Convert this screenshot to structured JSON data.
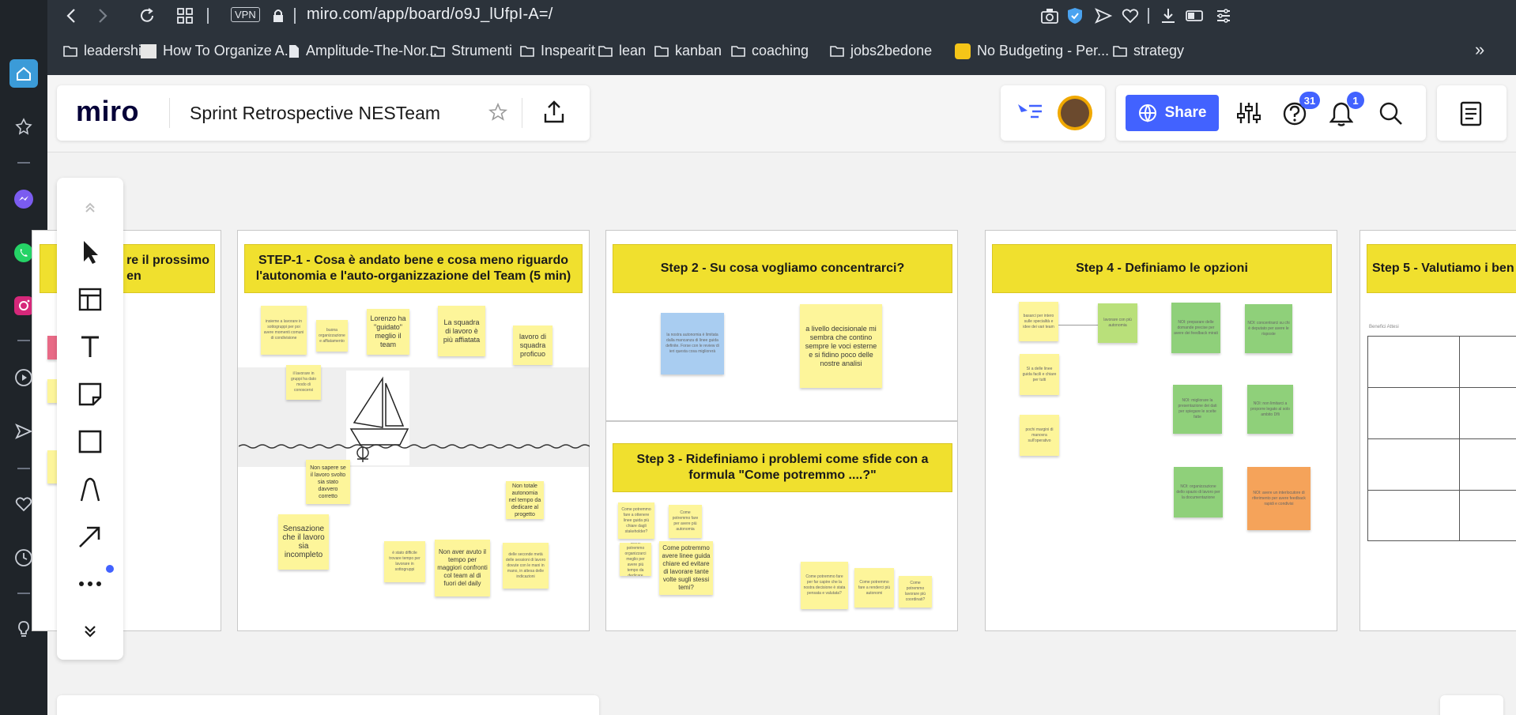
{
  "browser": {
    "vpn_label": "VPN",
    "url": "miro.com/app/board/o9J_lUfpI-A=/",
    "bookmarks_overflow": "»",
    "bookmarks": [
      {
        "label": "leadership",
        "icon": "folder-icon"
      },
      {
        "label": "How To Organize A...",
        "icon": "page-thumb-icon"
      },
      {
        "label": "Amplitude-The-Nor...",
        "icon": "document-icon"
      },
      {
        "label": "Strumenti",
        "icon": "folder-icon"
      },
      {
        "label": "Inspearit",
        "icon": "folder-icon"
      },
      {
        "label": "lean",
        "icon": "folder-icon"
      },
      {
        "label": "kanban",
        "icon": "folder-icon"
      },
      {
        "label": "coaching",
        "icon": "folder-icon"
      },
      {
        "label": "jobs2bedone",
        "icon": "folder-icon"
      },
      {
        "label": "No Budgeting - Per...",
        "icon": "favicon-icon"
      },
      {
        "label": "strategy",
        "icon": "folder-icon"
      }
    ]
  },
  "miro": {
    "logo": "miro",
    "board_title": "Sprint Retrospective NESTeam",
    "share_label": "Share",
    "help_badge": "31",
    "notif_badge": "1"
  },
  "frames": {
    "f0_header": "re     il prossimo\nen",
    "f1_header": "STEP-1 - Cosa è andato bene e cosa meno riguardo l'autonomia e l'auto-organizzazione del Team (5 min)",
    "f2_header": "Step 2 - Su cosa vogliamo concentrarci?",
    "f3_header": "Step 3 - Ridefiniamo i problemi come sfide con a formula \"Come potremmo ....?\"",
    "f4_header": "Step 4 - Definiamo le opzioni",
    "f5_header": "Step 5 - Valutiamo i ben",
    "f5_label": "Benefici Attesi"
  },
  "notes": {
    "s1_lorenzo": "Lorenzo ha \"guidato\" meglio il team",
    "s1_squadra": "La squadra di lavoro è più affiatata",
    "s1_lavoro": "lavoro di squadra proficuo",
    "s1_non_sapere": "Non sapere se il lavoro svolto sia stato davvero corretto",
    "s1_sensazione": "Sensazione che il lavoro sia incompleto",
    "s1_non_aver": "Non aver avuto il tempo per maggiori confronti col team al di fuori del daily",
    "s1_difficile": "è stato difficile trovare tempo per lavorare in sottogruppi",
    "s1_non_totale": "Non totale autonomia nel tempo da dedicare al progetto",
    "s1_tiny_a": "insieme a lavorare in sottogruppi per poi avere momenti comuni di condivisione",
    "s1_tiny_b": "buona organizzazione e affiatamento",
    "s1_tiny_c": "il lavorare in gruppi ha dato modo di conoscersi",
    "s1_tiny_d": "delle seconde metà delle sessioni di lavoro dovute con le mani in mano, in attesa delle indicazioni",
    "s2_blue": "la nostra autonomia è limitata dalla mancanza di linee guida definite. Forse con le review di ieri questa cosa migliorerà",
    "s2_yellow": "a livello decisionale mi sembra che contino sempre le voci esterne e si fidino poco delle nostre analisi",
    "s3_chiare": "Come potremmo avere linee guida chiare ed evitare di lavorare tante volte sugli stessi temi?",
    "s3_tiny_a": "Come potremmo fare a ottenere linee guida più chiare dagli stakeholder?",
    "s3_tiny_b": "Come potremmo fare per avere più autonomia",
    "s3_tiny_c": "Come potremmo organizzarci meglio per avere più tempo da dedicare",
    "s3_tiny_d": "Come potremmo fare per far capire che la nostra decisione è stata pensata e valutata?",
    "s3_tiny_e": "Come potremmo fare a renderci più autonomi",
    "s3_tiny_f": "Come potremmo lavorare più coordinati?",
    "s4_y1": "basarci per intero sulle specialità e idee dei vari team",
    "s4_y2": "Sì a delle linee guida facili e chiare per tutti",
    "s4_y3": "pochi margini di manovra sull'operativo",
    "s4_g0": "lavorare con più autonomia",
    "s4_g1": "NOI: preparare delle domande precise per avere dei feedback mirati",
    "s4_g2": "NOI: concentrarci su chi è deputato per avere le risposte",
    "s4_g3": "NOI: migliorare la presentazione dei dati per spiegare le scelte fatte",
    "s4_g4": "NOI: non limitarci a proporre legato al solo ambito Dfli",
    "s4_g5": "NOI: organizzazione dello spazio di lavoro per la documentazione",
    "s4_o1": "NOI: avere un interlocutore di riferimento per avere feedback rapidi e condivisi"
  }
}
